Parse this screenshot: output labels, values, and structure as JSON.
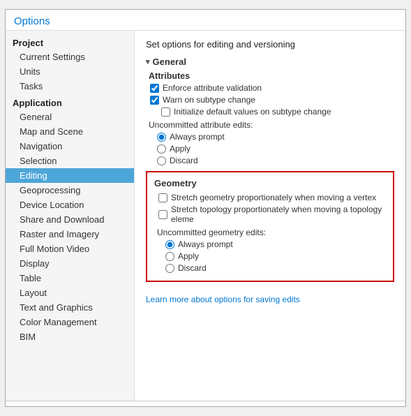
{
  "dialog": {
    "title": "Options"
  },
  "sidebar": {
    "groups": [
      {
        "label": "Project",
        "items": [
          "Current Settings",
          "Units",
          "Tasks"
        ]
      },
      {
        "label": "Application",
        "items": [
          "General",
          "Map and Scene",
          "Navigation",
          "Selection",
          "Editing",
          "Geoprocessing",
          "Device Location",
          "Share and Download",
          "Raster and Imagery",
          "Full Motion Video",
          "Display",
          "Table",
          "Layout",
          "Text and Graphics",
          "Color Management",
          "BIM"
        ]
      }
    ],
    "activeItem": "Editing"
  },
  "main": {
    "header": "Set options for editing and versioning",
    "generalSection": {
      "title": "General",
      "chevron": "▾",
      "attributesLabel": "Attributes",
      "enforceLabel": "Enforce attribute validation",
      "warnLabel": "Warn on subtype change",
      "initLabel": "Initialize default values on subtype change",
      "uncommittedLabel": "Uncommitted attribute edits:",
      "radioOptions": [
        "Always prompt",
        "Apply",
        "Discard"
      ],
      "enforceChecked": true,
      "warnChecked": true,
      "initChecked": false,
      "selectedRadio": "Always prompt"
    },
    "geometrySection": {
      "title": "Geometry",
      "stretchLabel": "Stretch geometry proportionately when moving a vertex",
      "stretchTopoLabel": "Stretch topology proportionately when moving a topology eleme",
      "uncommittedLabel": "Uncommitted geometry edits:",
      "radioOptions": [
        "Always prompt",
        "Apply",
        "Discard"
      ],
      "stretchChecked": false,
      "stretchTopoChecked": false,
      "selectedRadio": "Always prompt"
    },
    "learnLink": "Learn more about options for saving edits"
  }
}
